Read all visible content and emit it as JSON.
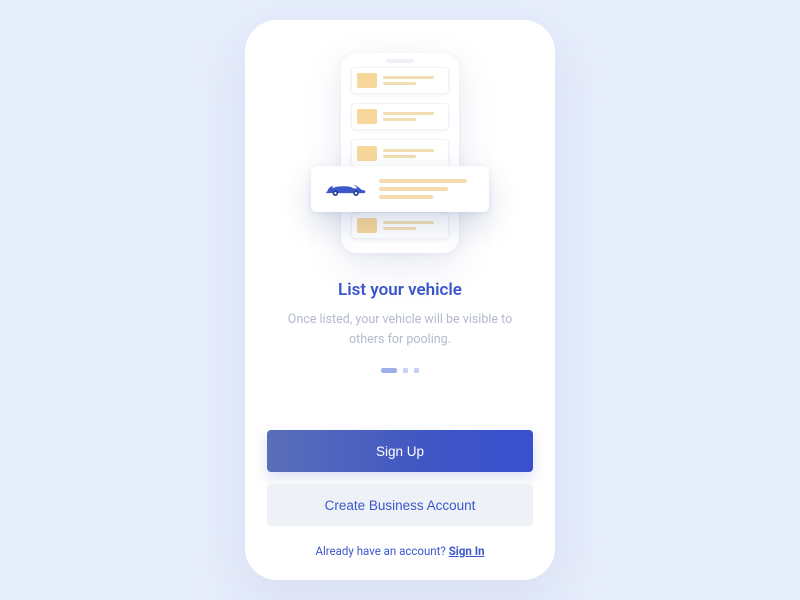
{
  "onboarding": {
    "title": "List your vehicle",
    "subtitle": "Once listed, your vehicle will be visible to others for pooling.",
    "page_index": 0,
    "page_count": 3
  },
  "actions": {
    "primary_label": "Sign Up",
    "secondary_label": "Create Business Account",
    "signin_prompt": "Already have an account? ",
    "signin_link": "Sign In"
  },
  "illustration": {
    "float_icon": "car-icon"
  },
  "colors": {
    "accent": "#3c57cc",
    "bg": "#e6edfb",
    "muted": "#b3bacd"
  }
}
